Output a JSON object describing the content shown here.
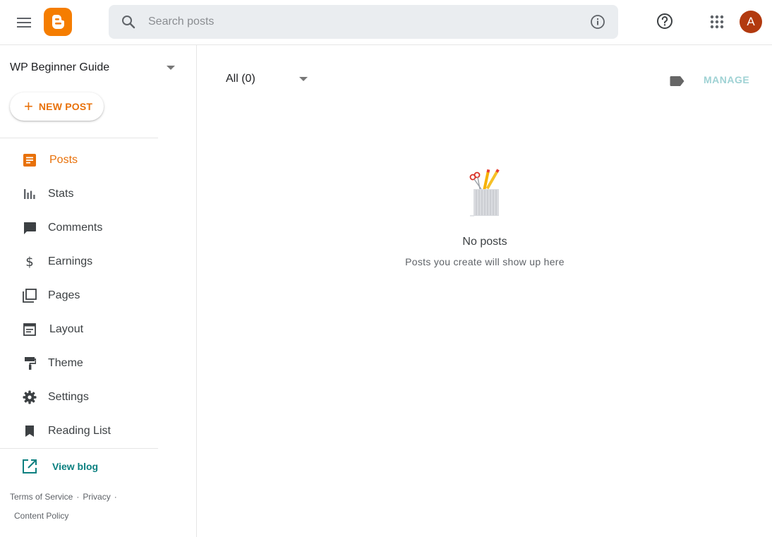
{
  "header": {
    "search_placeholder": "Search posts",
    "avatar_initial": "A"
  },
  "sidebar": {
    "blog_name": "WP Beginner Guide",
    "new_post_label": "NEW POST",
    "items": [
      {
        "label": "Posts",
        "icon": "posts-icon",
        "active": true
      },
      {
        "label": "Stats",
        "icon": "stats-icon"
      },
      {
        "label": "Comments",
        "icon": "comments-icon"
      },
      {
        "label": "Earnings",
        "icon": "dollar-icon"
      },
      {
        "label": "Pages",
        "icon": "pages-icon"
      },
      {
        "label": "Layout",
        "icon": "layout-icon"
      },
      {
        "label": "Theme",
        "icon": "paint-roller-icon"
      },
      {
        "label": "Settings",
        "icon": "gear-icon"
      },
      {
        "label": "Reading List",
        "icon": "bookmark-icon"
      }
    ],
    "view_blog_label": "View blog",
    "footer": {
      "terms": "Terms of Service",
      "privacy": "Privacy",
      "content_policy": "Content Policy",
      "separator": "·"
    }
  },
  "main": {
    "filter_value": "All (0)",
    "manage_label": "MANAGE",
    "empty_title": "No posts",
    "empty_subtitle": "Posts you create will show up here"
  },
  "colors": {
    "brand_orange": "#f57d00",
    "accent_orange": "#e8710a",
    "teal_link": "#0b8080",
    "avatar_bg": "#b23a0f",
    "manage_disabled": "#9fd2d4"
  }
}
